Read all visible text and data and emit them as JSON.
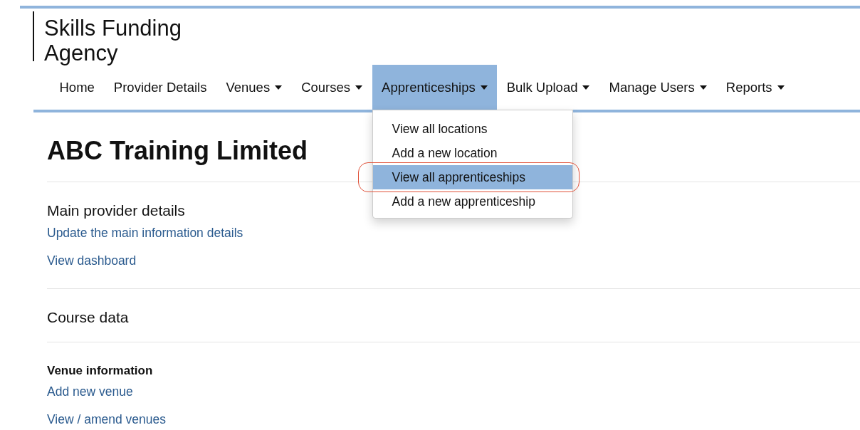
{
  "logo": {
    "lines": [
      "Skills Funding",
      "Agency"
    ]
  },
  "nav": [
    {
      "label": "Home",
      "dropdown": false,
      "selected": false
    },
    {
      "label": "Provider Details",
      "dropdown": false,
      "selected": false
    },
    {
      "label": "Venues",
      "dropdown": true,
      "selected": false
    },
    {
      "label": "Courses",
      "dropdown": true,
      "selected": false
    },
    {
      "label": "Apprenticeships",
      "dropdown": true,
      "selected": true,
      "menu": [
        {
          "label": "View all locations",
          "selected": false,
          "circled": false
        },
        {
          "label": "Add a new location",
          "selected": false,
          "circled": false
        },
        {
          "label": "View all apprenticeships",
          "selected": true,
          "circled": true
        },
        {
          "label": "Add a new apprenticeship",
          "selected": false,
          "circled": false
        }
      ]
    },
    {
      "label": "Bulk Upload",
      "dropdown": true,
      "selected": false
    },
    {
      "label": "Manage Users",
      "dropdown": true,
      "selected": false
    },
    {
      "label": "Reports",
      "dropdown": true,
      "selected": false
    }
  ],
  "title": "ABC Training Limited",
  "sections": [
    {
      "heading": "Main provider details",
      "links": [
        "Update the main information details",
        "View dashboard"
      ]
    },
    {
      "heading": "Course data",
      "subsections": [
        {
          "heading": "Venue information",
          "links": [
            "Add new venue",
            "View / amend venues"
          ]
        }
      ]
    }
  ]
}
